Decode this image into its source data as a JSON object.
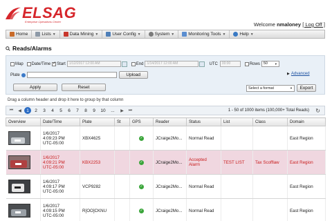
{
  "brand": {
    "name": "ELSAG",
    "tagline": "Enterprise Operations Center",
    "colors": {
      "brand": "#d6262b",
      "accent": "#2b6cc4",
      "alert_row": "#f0d7e0"
    }
  },
  "header": {
    "welcome_prefix": "Welcome",
    "username": "nmaloney",
    "logoff_label": "[ Log Off ]"
  },
  "menu": [
    {
      "label": "Home",
      "icon": "home-icon"
    },
    {
      "label": "Lists",
      "icon": "list-icon"
    },
    {
      "label": "Data Mining",
      "icon": "data-mining-icon"
    },
    {
      "label": "User Config",
      "icon": "user-icon"
    },
    {
      "label": "System",
      "icon": "gear-icon"
    },
    {
      "label": "Monitoring Tools",
      "icon": "monitor-icon"
    },
    {
      "label": "Help",
      "icon": "help-icon"
    }
  ],
  "page": {
    "title": "Reads/Alarms"
  },
  "filters": {
    "map_label": "Map",
    "datetime_label": "Date/Time",
    "start_label": "Start",
    "start_value": "1/12/2017 12:00 AM",
    "end_label": "End",
    "end_value": "1/14/2017 12:00 AM",
    "utc_label": "UTC",
    "utc_value": "00:00",
    "rows_label": "Rows",
    "rows_value": "50",
    "plate_label": "Plate",
    "upload_label": "Upload",
    "advanced_label": "Advanced",
    "apply_label": "Apply",
    "reset_label": "Reset",
    "format_value": "Select a format",
    "export_label": "Export"
  },
  "grouping_hint": "Drag a column header and drop it here to group by that column",
  "pager": {
    "pages": [
      "1",
      "2",
      "3",
      "4",
      "5",
      "6",
      "7",
      "8",
      "9",
      "10",
      "..."
    ],
    "info": "1 - 50 of 1000 items (100,000+ Total Reads)"
  },
  "table": {
    "columns": [
      "Overview",
      "Date/Time",
      "Plate",
      "St",
      "GPS",
      "Reader",
      "Status",
      "List",
      "Class",
      "Domain"
    ],
    "rows": [
      {
        "date": "1/6/2017",
        "time": "4:09:23 PM",
        "tz": "UTC-05:00",
        "plate": "XBX4625",
        "st": "",
        "gps": true,
        "reader": "JCraige2Mo...",
        "status": "Normal Read",
        "list": "",
        "class": "",
        "domain": "East Region",
        "alert": false
      },
      {
        "date": "1/6/2017",
        "time": "4:09:21 PM",
        "tz": "UTC-05:00",
        "plate": "KBX2253",
        "st": "",
        "gps": true,
        "reader": "JCraige2Mo...",
        "status": "Accepted Alarm",
        "list": "TEST LIST",
        "class": "Tax Scofflaw",
        "domain": "East Region",
        "alert": true
      },
      {
        "date": "1/6/2017",
        "time": "4:09:17 PM",
        "tz": "UTC-05:00",
        "plate": "VCP9282",
        "st": "",
        "gps": true,
        "reader": "JCraige2Mo...",
        "status": "Normal Read",
        "list": "",
        "class": "",
        "domain": "East Region",
        "alert": false
      },
      {
        "date": "1/6/2017",
        "time": "4:09:15 PM",
        "tz": "UTC-05:00",
        "plate": "R[OO]CKNU",
        "st": "",
        "gps": true,
        "reader": "JCraige2Mo...",
        "status": "Normal Read",
        "list": "",
        "class": "",
        "domain": "East Region",
        "alert": false
      }
    ]
  }
}
